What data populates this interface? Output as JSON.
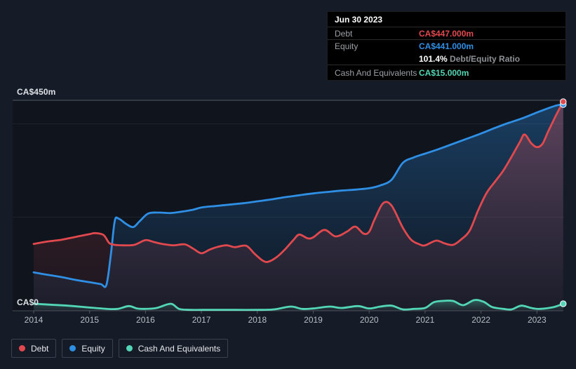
{
  "colors": {
    "background": "#161c27",
    "plot_background": "#0f141d",
    "tooltip_background": "#000000",
    "grid_strong": "rgba(255,255,255,0.28)",
    "grid_faint": "rgba(255,255,255,0.07)",
    "axis_line": "rgba(255,255,255,0.22)",
    "tick_mark": "rgba(255,255,255,0.25)",
    "axis_text": "#b9bdc5",
    "marker_stroke": "#e9edf3"
  },
  "tooltip": {
    "date": "Jun 30 2023",
    "debt_label": "Debt",
    "debt_value": "CA$447.000m",
    "equity_label": "Equity",
    "equity_value": "CA$441.000m",
    "ratio_value": "101.4%",
    "ratio_label": "Debt/Equity Ratio",
    "cash_label": "Cash And Equivalents",
    "cash_value": "CA$15.000m"
  },
  "chart_data": {
    "type": "area",
    "title": "",
    "xlabel": "",
    "ylabel": "",
    "y_axis": {
      "top_label": "CA$450m",
      "bottom_label": "CA$0",
      "max": 450,
      "min": 0,
      "unit": "CA$m",
      "gridlines_m": [
        200,
        400
      ]
    },
    "x_ticks": [
      "2014",
      "2015",
      "2016",
      "2017",
      "2018",
      "2019",
      "2020",
      "2021",
      "2022",
      "2023"
    ],
    "x_range": [
      2014.0,
      2023.47
    ],
    "legend_position": "bottom-left",
    "series": [
      {
        "name": "Debt",
        "color": "#e2494e",
        "end_value_m": 447,
        "points": [
          [
            2014.0,
            143
          ],
          [
            2014.25,
            148
          ],
          [
            2014.5,
            152
          ],
          [
            2014.75,
            158
          ],
          [
            2015.0,
            164
          ],
          [
            2015.1,
            166
          ],
          [
            2015.25,
            162
          ],
          [
            2015.35,
            145
          ],
          [
            2015.45,
            141
          ],
          [
            2015.6,
            140
          ],
          [
            2015.8,
            141
          ],
          [
            2016.0,
            151
          ],
          [
            2016.15,
            147
          ],
          [
            2016.3,
            143
          ],
          [
            2016.5,
            140
          ],
          [
            2016.7,
            142
          ],
          [
            2016.85,
            133
          ],
          [
            2017.0,
            123
          ],
          [
            2017.15,
            131
          ],
          [
            2017.3,
            137
          ],
          [
            2017.45,
            140
          ],
          [
            2017.6,
            136
          ],
          [
            2017.8,
            139
          ],
          [
            2017.95,
            122
          ],
          [
            2018.1,
            107
          ],
          [
            2018.2,
            105
          ],
          [
            2018.35,
            115
          ],
          [
            2018.5,
            132
          ],
          [
            2018.65,
            152
          ],
          [
            2018.75,
            163
          ],
          [
            2018.9,
            155
          ],
          [
            2019.0,
            157
          ],
          [
            2019.2,
            173
          ],
          [
            2019.4,
            159
          ],
          [
            2019.6,
            169
          ],
          [
            2019.75,
            180
          ],
          [
            2019.9,
            165
          ],
          [
            2020.0,
            169
          ],
          [
            2020.1,
            196
          ],
          [
            2020.25,
            230
          ],
          [
            2020.4,
            225
          ],
          [
            2020.6,
            178
          ],
          [
            2020.75,
            152
          ],
          [
            2020.9,
            142
          ],
          [
            2021.0,
            140
          ],
          [
            2021.2,
            150
          ],
          [
            2021.35,
            144
          ],
          [
            2021.5,
            141
          ],
          [
            2021.65,
            153
          ],
          [
            2021.8,
            172
          ],
          [
            2021.95,
            215
          ],
          [
            2022.1,
            252
          ],
          [
            2022.25,
            276
          ],
          [
            2022.4,
            300
          ],
          [
            2022.55,
            330
          ],
          [
            2022.7,
            362
          ],
          [
            2022.78,
            377
          ],
          [
            2022.9,
            358
          ],
          [
            2023.0,
            350
          ],
          [
            2023.1,
            357
          ],
          [
            2023.2,
            383
          ],
          [
            2023.35,
            420
          ],
          [
            2023.47,
            447
          ]
        ]
      },
      {
        "name": "Equity",
        "color": "#2f8fe5",
        "end_value_m": 441,
        "points": [
          [
            2014.0,
            82
          ],
          [
            2014.25,
            77
          ],
          [
            2014.5,
            72
          ],
          [
            2014.75,
            66
          ],
          [
            2015.0,
            61
          ],
          [
            2015.2,
            57
          ],
          [
            2015.3,
            55
          ],
          [
            2015.38,
            120
          ],
          [
            2015.45,
            192
          ],
          [
            2015.52,
            197
          ],
          [
            2015.65,
            186
          ],
          [
            2015.78,
            179
          ],
          [
            2015.9,
            192
          ],
          [
            2016.05,
            208
          ],
          [
            2016.25,
            210
          ],
          [
            2016.45,
            209
          ],
          [
            2016.65,
            212
          ],
          [
            2016.85,
            216
          ],
          [
            2017.0,
            221
          ],
          [
            2017.25,
            224
          ],
          [
            2017.5,
            227
          ],
          [
            2017.75,
            230
          ],
          [
            2018.0,
            234
          ],
          [
            2018.25,
            238
          ],
          [
            2018.5,
            243
          ],
          [
            2018.75,
            247
          ],
          [
            2019.0,
            251
          ],
          [
            2019.25,
            254
          ],
          [
            2019.5,
            257
          ],
          [
            2019.75,
            259
          ],
          [
            2020.0,
            262
          ],
          [
            2020.2,
            268
          ],
          [
            2020.4,
            280
          ],
          [
            2020.6,
            316
          ],
          [
            2020.8,
            328
          ],
          [
            2021.0,
            336
          ],
          [
            2021.25,
            346
          ],
          [
            2021.5,
            357
          ],
          [
            2021.75,
            368
          ],
          [
            2022.0,
            379
          ],
          [
            2022.25,
            391
          ],
          [
            2022.5,
            402
          ],
          [
            2022.75,
            412
          ],
          [
            2023.0,
            424
          ],
          [
            2023.2,
            433
          ],
          [
            2023.35,
            439
          ],
          [
            2023.47,
            441
          ]
        ]
      },
      {
        "name": "Cash And Equivalents",
        "color": "#53d6b5",
        "end_value_m": 15,
        "points": [
          [
            2014.0,
            15
          ],
          [
            2014.3,
            13
          ],
          [
            2014.6,
            11
          ],
          [
            2014.9,
            8
          ],
          [
            2015.1,
            6
          ],
          [
            2015.3,
            4
          ],
          [
            2015.5,
            4
          ],
          [
            2015.7,
            10
          ],
          [
            2015.85,
            5
          ],
          [
            2016.0,
            4
          ],
          [
            2016.2,
            6
          ],
          [
            2016.45,
            15
          ],
          [
            2016.6,
            4
          ],
          [
            2016.8,
            2
          ],
          [
            2017.0,
            2
          ],
          [
            2017.3,
            2
          ],
          [
            2017.6,
            2
          ],
          [
            2018.0,
            2
          ],
          [
            2018.3,
            3
          ],
          [
            2018.6,
            9
          ],
          [
            2018.8,
            4
          ],
          [
            2019.0,
            5
          ],
          [
            2019.3,
            9
          ],
          [
            2019.5,
            6
          ],
          [
            2019.8,
            10
          ],
          [
            2020.0,
            5
          ],
          [
            2020.2,
            9
          ],
          [
            2020.4,
            11
          ],
          [
            2020.6,
            3
          ],
          [
            2020.8,
            4
          ],
          [
            2021.0,
            6
          ],
          [
            2021.15,
            18
          ],
          [
            2021.3,
            21
          ],
          [
            2021.5,
            21
          ],
          [
            2021.68,
            12
          ],
          [
            2021.88,
            23
          ],
          [
            2022.05,
            19
          ],
          [
            2022.2,
            8
          ],
          [
            2022.4,
            4
          ],
          [
            2022.55,
            3
          ],
          [
            2022.72,
            11
          ],
          [
            2022.9,
            6
          ],
          [
            2023.05,
            4
          ],
          [
            2023.3,
            8
          ],
          [
            2023.47,
            15
          ]
        ]
      }
    ]
  }
}
